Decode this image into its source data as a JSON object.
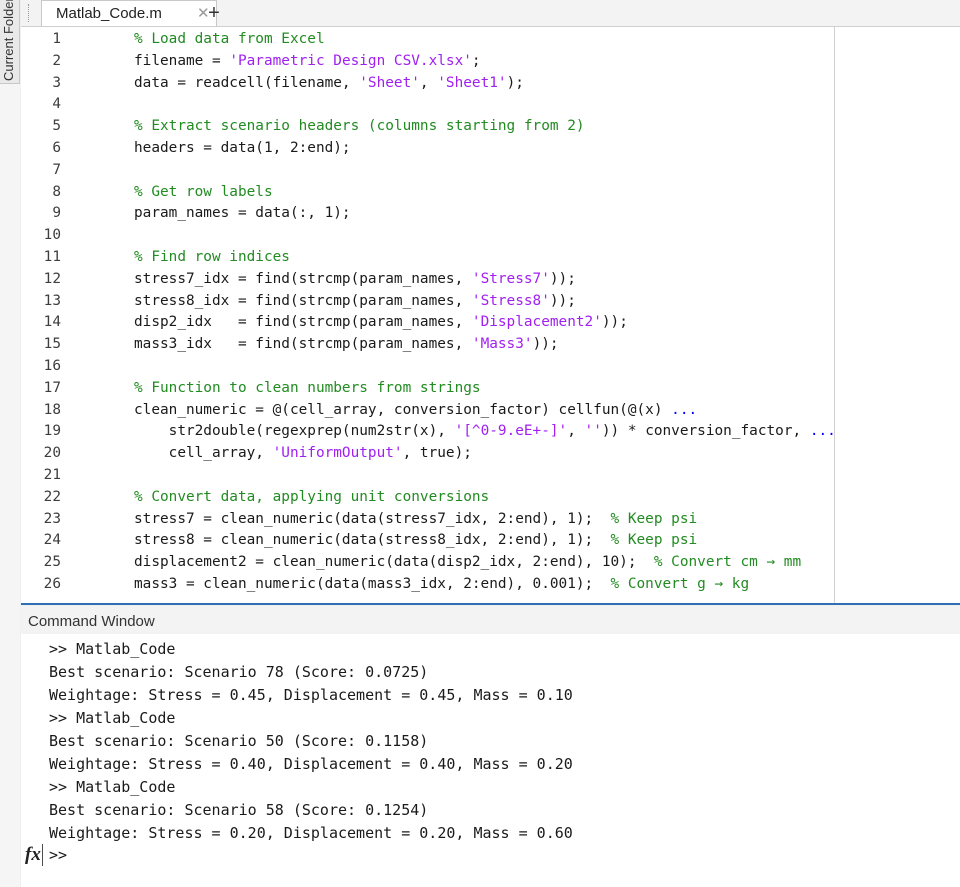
{
  "sidebar": {
    "label": "Current Folder"
  },
  "editor": {
    "tab_name": "Matlab_Code.m",
    "close_glyph": "✕",
    "add_glyph": "+",
    "lines": [
      {
        "n": "1",
        "html": "<span class=\"cm\">% Load data from Excel</span>"
      },
      {
        "n": "2",
        "html": "filename = <span class=\"str\">'Parametric Design CSV.xlsx'</span>;"
      },
      {
        "n": "3",
        "html": "data = readcell(filename, <span class=\"str\">'Sheet'</span>, <span class=\"str\">'Sheet1'</span>);"
      },
      {
        "n": "4",
        "html": ""
      },
      {
        "n": "5",
        "html": "<span class=\"cm\">% Extract scenario headers (columns starting from 2)</span>"
      },
      {
        "n": "6",
        "html": "headers = data(1, 2:end);"
      },
      {
        "n": "7",
        "html": ""
      },
      {
        "n": "8",
        "html": "<span class=\"cm\">% Get row labels</span>"
      },
      {
        "n": "9",
        "html": "param_names = data(:, 1);"
      },
      {
        "n": "10",
        "html": ""
      },
      {
        "n": "11",
        "html": "<span class=\"cm\">% Find row indices</span>"
      },
      {
        "n": "12",
        "html": "stress7_idx = find(strcmp(param_names, <span class=\"str\">'Stress7'</span>));"
      },
      {
        "n": "13",
        "html": "stress8_idx = find(strcmp(param_names, <span class=\"str\">'Stress8'</span>));"
      },
      {
        "n": "14",
        "html": "disp2_idx   = find(strcmp(param_names, <span class=\"str\">'Displacement2'</span>));"
      },
      {
        "n": "15",
        "html": "mass3_idx   = find(strcmp(param_names, <span class=\"str\">'Mass3'</span>));"
      },
      {
        "n": "16",
        "html": ""
      },
      {
        "n": "17",
        "html": "<span class=\"cm\">% Function to clean numbers from strings</span>"
      },
      {
        "n": "18",
        "html": "clean_numeric = @(cell_array, conversion_factor) cellfun(@(x) <span class=\"kw\">...</span>"
      },
      {
        "n": "19",
        "html": "    str2double(regexprep(num2str(x), <span class=\"str\">'[^0-9.eE+-]'</span>, <span class=\"str\">''</span>)) * conversion_factor, <span class=\"kw\">...</span>"
      },
      {
        "n": "20",
        "html": "    cell_array, <span class=\"str\">'UniformOutput'</span>, true);"
      },
      {
        "n": "21",
        "html": ""
      },
      {
        "n": "22",
        "html": "<span class=\"cm\">% Convert data, applying unit conversions</span>"
      },
      {
        "n": "23",
        "html": "stress7 = clean_numeric(data(stress7_idx, 2:end), 1);  <span class=\"cm\">% Keep psi</span>"
      },
      {
        "n": "24",
        "html": "stress8 = clean_numeric(data(stress8_idx, 2:end), 1);  <span class=\"cm\">% Keep psi</span>"
      },
      {
        "n": "25",
        "html": "displacement2 = clean_numeric(data(disp2_idx, 2:end), 10);  <span class=\"cm\">% Convert cm → mm</span>"
      },
      {
        "n": "26",
        "html": "mass3 = clean_numeric(data(mass3_idx, 2:end), 0.001);  <span class=\"cm\">% Convert g → kg</span>"
      }
    ]
  },
  "command_window": {
    "title": "Command Window",
    "lines": [
      ">> Matlab_Code",
      "Best scenario: Scenario 78 (Score: 0.0725)",
      "Weightage: Stress = 0.45, Displacement = 0.45, Mass = 0.10",
      ">> Matlab_Code",
      "Best scenario: Scenario 50 (Score: 0.1158)",
      "Weightage: Stress = 0.40, Displacement = 0.40, Mass = 0.20",
      ">> Matlab_Code",
      "Best scenario: Scenario 58 (Score: 0.1254)",
      "Weightage: Stress = 0.20, Displacement = 0.20, Mass = 0.60"
    ],
    "fx_label": "fx",
    "prompt": ">>"
  }
}
